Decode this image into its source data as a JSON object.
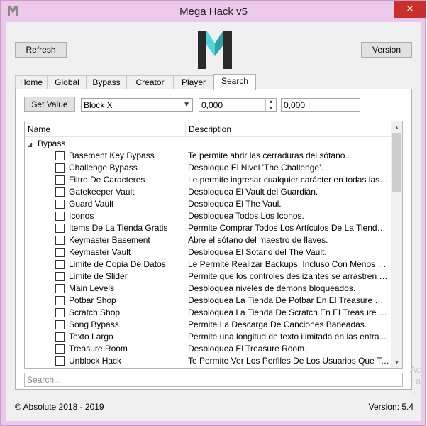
{
  "window": {
    "title": "Mega Hack v5",
    "close_glyph": "✕",
    "accent_color": "#ecc8ea",
    "close_color": "#c9302c"
  },
  "toolbar": {
    "refresh_label": "Refresh",
    "version_label": "Version"
  },
  "logo": {
    "icon": "mega-hack-logo",
    "color": "#3dc3c8"
  },
  "tabs": [
    {
      "label": "Home",
      "active": false
    },
    {
      "label": "Global",
      "active": false
    },
    {
      "label": "Bypass",
      "active": false
    },
    {
      "label": "Creator",
      "active": false
    },
    {
      "label": "Player",
      "active": false
    },
    {
      "label": "Search",
      "active": true
    }
  ],
  "search_tab": {
    "set_value_label": "Set Value",
    "block_select": "Block X",
    "value_field": "0,000",
    "value_field_2": "0,000",
    "search_placeholder": "Search..."
  },
  "list": {
    "columns": [
      "Name",
      "Description"
    ],
    "group": "Bypass",
    "items": [
      {
        "name": "Basement Key Bypass",
        "desc": "Te permite abrir las cerraduras del sótano..",
        "checked": false
      },
      {
        "name": "Challenge Bypass",
        "desc": "Desbloque El Nivel 'The Challenge'.",
        "checked": false
      },
      {
        "name": "Filtro De Caracteres",
        "desc": "Le permite ingresar cualquier carácter en todas las e...",
        "checked": false
      },
      {
        "name": "Gatekeeper Vault",
        "desc": "Desbloquea El Vault del Guardián.",
        "checked": false
      },
      {
        "name": "Guard Vault",
        "desc": "Desbloquea El The Vaul.",
        "checked": false
      },
      {
        "name": "Iconos",
        "desc": "Desbloquea Todos Los Iconos.",
        "checked": false
      },
      {
        "name": "Items De La Tienda Gratis",
        "desc": "Permite Comprar Todos Los Artículos De La Tienda ...",
        "checked": false
      },
      {
        "name": "Keymaster Basement",
        "desc": "Abre el sótano del maestro de llaves.",
        "checked": false
      },
      {
        "name": "Keymaster Vault",
        "desc": "Desbloquea El Sotano del The Vault.",
        "checked": false
      },
      {
        "name": "Limite de Copia De Datos",
        "desc": "Le Permite Realizar Backups, Incluso Con Menos De...",
        "checked": false
      },
      {
        "name": "Limite de Slider",
        "desc": "Permite que los controles deslizantes se arrastren m...",
        "checked": false
      },
      {
        "name": "Main Levels",
        "desc": "Desbloquea niveles de demons bloqueados.",
        "checked": false
      },
      {
        "name": "Potbar Shop",
        "desc": "Desbloquea La Tienda De Potbar En El Treasure Roo...",
        "checked": false
      },
      {
        "name": "Scratch Shop",
        "desc": "Desbloquea La Tienda De Scratch En El Treasure Ro...",
        "checked": false
      },
      {
        "name": "Song Bypass",
        "desc": "Permite La Descarga De Canciones Baneadas.",
        "checked": false
      },
      {
        "name": "Texto Largo",
        "desc": "Permite una longitud de texto ilimitada en las entra...",
        "checked": false
      },
      {
        "name": "Treasure Room",
        "desc": "Desbloquea El Treasure Room.",
        "checked": false
      },
      {
        "name": "Unblock Hack",
        "desc": "Te Permite Ver Los Perfiles De Los Usuarios Que Te ...",
        "checked": false
      }
    ]
  },
  "footer": {
    "copyright": "© Absolute 2018 - 2019",
    "version": "Version: 5.4"
  },
  "watermark": "Ac\nr a\nu"
}
